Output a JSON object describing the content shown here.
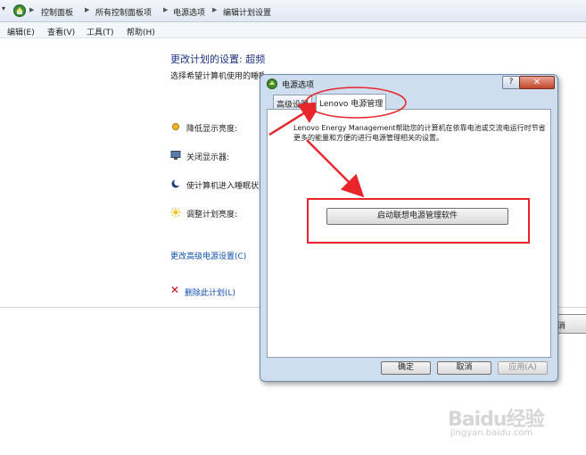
{
  "address": {
    "nav_label": "▾",
    "crumbs": [
      "控制面板",
      "所有控制面板项",
      "电源选项",
      "编辑计划设置"
    ],
    "logo_icon": "control-panel-icon"
  },
  "menu": [
    "编辑(E)",
    "查看(V)",
    "工具(T)",
    "帮助(H)"
  ],
  "main": {
    "title": "更改计划的设置: 超频",
    "subtitle": "选择希望计算机使用的睡眠设置和显示设置。",
    "settings": [
      {
        "label": "降低显示亮度:",
        "icon": "brightness-dim-icon"
      },
      {
        "label": "关闭显示器:",
        "icon": "monitor-icon"
      },
      {
        "label": "使计算机进入睡眠状态:",
        "icon": "sleep-moon-icon"
      },
      {
        "label": "调整计划亮度:",
        "icon": "sun-icon"
      }
    ],
    "advanced_link": "更改高级电源设置(C)",
    "delete_link": "删除此计划(L)",
    "bg_button_fragment": "消"
  },
  "dialog": {
    "title": "电源选项",
    "help": "?",
    "close": "✕",
    "tabs": [
      "高级设置",
      "Lenovo 电源管理"
    ],
    "active_tab": 1,
    "description": "Lenovo Energy Management帮助您的计算机在依靠电池或交流电运行时节省更多的能量和方便的进行电源管理相关的设置。",
    "launch_button": "启动联想电源管理软件",
    "ok": "确定",
    "cancel": "取消",
    "apply": "应用(A)"
  },
  "annotation": {
    "color": "#e8252b"
  },
  "watermark": {
    "brand": "Baidu经验",
    "url": "jingyan.baidu.com"
  }
}
